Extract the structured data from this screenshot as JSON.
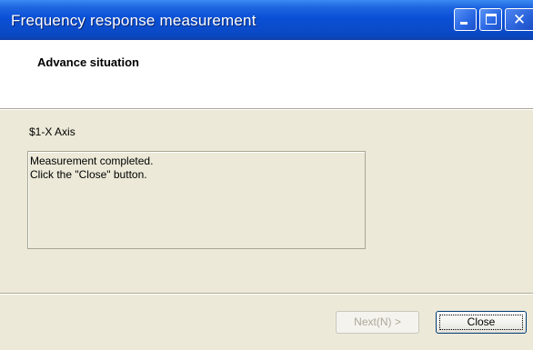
{
  "window": {
    "title": "Frequency response measurement",
    "controls": {
      "minimize": "minimize-icon",
      "maximize": "maximize-icon",
      "close": "close-icon"
    }
  },
  "header": {
    "heading": "Advance situation"
  },
  "body": {
    "axis_label": "$1-X Axis",
    "message_lines": [
      "Measurement completed.",
      "Click the \"Close\" button."
    ]
  },
  "footer": {
    "next_label": "Next(N) >",
    "next_enabled": false,
    "close_label": "Close"
  },
  "colors": {
    "titlebar": "#0A4FD6",
    "dialog_background": "#ECE9D8",
    "header_background": "#FFFFFF",
    "disabled_text": "#ACA899"
  }
}
